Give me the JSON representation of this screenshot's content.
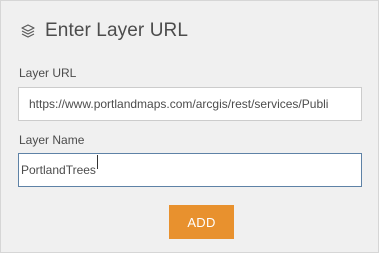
{
  "header": {
    "icon": "layers-icon",
    "title": "Enter Layer URL"
  },
  "form": {
    "url_label": "Layer URL",
    "url_value": "https://www.portlandmaps.com/arcgis/rest/services/Publi",
    "name_label": "Layer Name",
    "name_value": "PortlandTrees"
  },
  "actions": {
    "add_label": "ADD"
  },
  "colors": {
    "panel_bg": "#f0f0f0",
    "accent_button": "#e8912e",
    "focus_border": "#5e82a6",
    "text": "#4c4c4c"
  }
}
